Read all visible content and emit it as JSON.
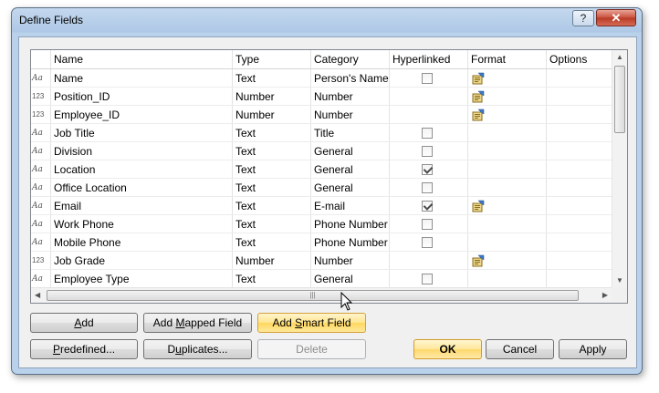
{
  "window": {
    "title": "Define Fields",
    "help_label": "?",
    "close_label": "✕"
  },
  "grid": {
    "columns": [
      "",
      "Name",
      "Type",
      "Category",
      "Hyperlinked",
      "Format",
      "Options"
    ],
    "rows": [
      {
        "icon": "Aa",
        "name": "Name",
        "type": "Text",
        "category": "Person's Name",
        "hyperlink": "unchecked",
        "format": true
      },
      {
        "icon": "123",
        "name": "Position_ID",
        "type": "Number",
        "category": "Number",
        "hyperlink": "none",
        "format": true
      },
      {
        "icon": "123",
        "name": "Employee_ID",
        "type": "Number",
        "category": "Number",
        "hyperlink": "none",
        "format": true
      },
      {
        "icon": "Aa",
        "name": "Job Title",
        "type": "Text",
        "category": "Title",
        "hyperlink": "unchecked",
        "format": false
      },
      {
        "icon": "Aa",
        "name": "Division",
        "type": "Text",
        "category": "General",
        "hyperlink": "unchecked",
        "format": false
      },
      {
        "icon": "Aa",
        "name": "Location",
        "type": "Text",
        "category": "General",
        "hyperlink": "checked",
        "format": false
      },
      {
        "icon": "Aa",
        "name": "Office Location",
        "type": "Text",
        "category": "General",
        "hyperlink": "unchecked",
        "format": false
      },
      {
        "icon": "Aa",
        "name": "Email",
        "type": "Text",
        "category": "E-mail",
        "hyperlink": "checked",
        "format": true
      },
      {
        "icon": "Aa",
        "name": "Work Phone",
        "type": "Text",
        "category": "Phone Number",
        "hyperlink": "unchecked",
        "format": false
      },
      {
        "icon": "Aa",
        "name": "Mobile Phone",
        "type": "Text",
        "category": "Phone Number",
        "hyperlink": "unchecked",
        "format": false
      },
      {
        "icon": "123",
        "name": "Job Grade",
        "type": "Number",
        "category": "Number",
        "hyperlink": "none",
        "format": true
      },
      {
        "icon": "Aa",
        "name": "Employee Type",
        "type": "Text",
        "category": "General",
        "hyperlink": "unchecked",
        "format": false
      }
    ]
  },
  "buttons": {
    "add": {
      "pre": "",
      "key": "A",
      "post": "dd"
    },
    "add_mapped": {
      "pre": "Add ",
      "key": "M",
      "post": "apped Field"
    },
    "add_smart": {
      "pre": "Add ",
      "key": "S",
      "post": "mart Field"
    },
    "predefined": {
      "pre": "",
      "key": "P",
      "post": "redefined..."
    },
    "duplicates": {
      "pre": "D",
      "key": "u",
      "post": "plicates..."
    },
    "delete": "Delete",
    "ok": "OK",
    "cancel": "Cancel",
    "apply": "Apply"
  },
  "colors": {
    "title_bar": "#b9d1ea",
    "hot_button": "#ffd75e",
    "close": "#c8503c"
  }
}
